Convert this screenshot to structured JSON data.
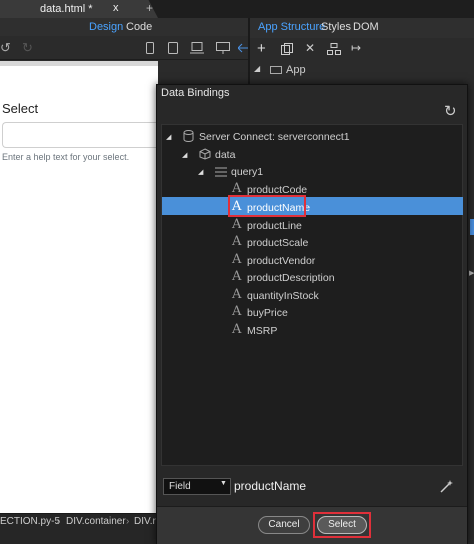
{
  "window": {
    "tab_title": "data.html *",
    "tab_close": "x",
    "tab_add": "+"
  },
  "editor": {
    "design_tab": "Design",
    "code_tab": "Code",
    "canvas": {
      "label": "Select",
      "help_text": "Enter a help text for your select."
    }
  },
  "structure_panel": {
    "tabs": [
      "App Structure",
      "Styles",
      "DOM"
    ],
    "root_node": "App"
  },
  "statusbar": {
    "crumbs": [
      "ECTION.py-5",
      "DIV.container",
      "DIV.ro"
    ]
  },
  "dialog": {
    "title": "Data Bindings",
    "tree": {
      "server_connect": "Server Connect: serverconnect1",
      "data": "data",
      "query": "query1",
      "fields": [
        "productCode",
        "productName",
        "productLine",
        "productScale",
        "productVendor",
        "productDescription",
        "quantityInStock",
        "buyPrice",
        "MSRP"
      ],
      "selected_field": "productName"
    },
    "field_type": "Field",
    "field_value": "productName",
    "cancel_label": "Cancel",
    "select_label": "Select"
  },
  "colors": {
    "accent": "#4a90d9",
    "highlight_outline": "#e0303a",
    "link_blue": "#4aa3ff"
  },
  "icons": {
    "field": "letter-a-icon",
    "refresh": "refresh-icon",
    "magic": "magic-wand-icon"
  }
}
